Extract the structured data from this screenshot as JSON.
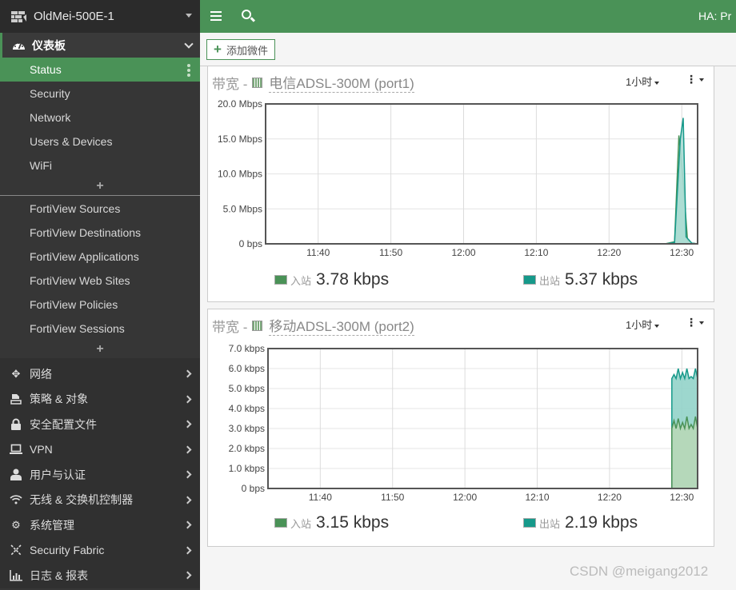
{
  "sidebar": {
    "device_name": "OldMei-500E-1",
    "dashboard_label": "仪表板",
    "dashboard_items": [
      {
        "label": "Status",
        "active": true
      },
      {
        "label": "Security"
      },
      {
        "label": "Network"
      },
      {
        "label": "Users & Devices"
      },
      {
        "label": "WiFi"
      }
    ],
    "add_label": "+",
    "fortiview_items": [
      {
        "label": "FortiView Sources"
      },
      {
        "label": "FortiView Destinations"
      },
      {
        "label": "FortiView Applications"
      },
      {
        "label": "FortiView Web Sites"
      },
      {
        "label": "FortiView Policies"
      },
      {
        "label": "FortiView Sessions"
      }
    ],
    "nav_items": [
      {
        "label": "网络",
        "icon": "move-arrows-icon"
      },
      {
        "label": "策略 & 对象",
        "icon": "policy-icon"
      },
      {
        "label": "安全配置文件",
        "icon": "lock-icon"
      },
      {
        "label": "VPN",
        "icon": "laptop-icon"
      },
      {
        "label": "用户与认证",
        "icon": "user-icon"
      },
      {
        "label": "无线 & 交换机控制器",
        "icon": "wifi-icon"
      },
      {
        "label": "系统管理",
        "icon": "gear-icon"
      },
      {
        "label": "Security Fabric",
        "icon": "fabric-icon"
      },
      {
        "label": "日志 & 报表",
        "icon": "bar-chart-icon"
      }
    ]
  },
  "topbar": {
    "ha_label": "HA: Pr"
  },
  "toolbar": {
    "add_widget_label": "添加微件"
  },
  "colors": {
    "accent": "#4a9257",
    "inbound": "#4a9257",
    "outbound": "#16998a"
  },
  "chart_data": [
    {
      "type": "area",
      "title": "带宽 -",
      "interface": "电信ADSL-300M (port1)",
      "time_range": "1小时",
      "xlabel": "",
      "ylabel": "",
      "x_ticks": [
        "11:40",
        "11:50",
        "12:00",
        "12:10",
        "12:20",
        "12:30"
      ],
      "y_ticks": [
        "0 bps",
        "5.0 Mbps",
        "10.0 Mbps",
        "15.0 Mbps",
        "20.0 Mbps"
      ],
      "ylim": [
        0,
        20
      ],
      "y_unit": "Mbps",
      "x_range_minutes": [
        0,
        60
      ],
      "grid": true,
      "series": [
        {
          "name": "入站",
          "color": "#4a9257",
          "fill": "#c8e2c8",
          "x": [
            0,
            55.5,
            56.8,
            57.4,
            58.0,
            58.6,
            59.2,
            60
          ],
          "values": [
            0,
            0,
            0.3,
            15.5,
            9.0,
            0.5,
            0.1,
            0
          ]
        },
        {
          "name": "出站",
          "color": "#16998a",
          "fill": "#a8dcd4",
          "x": [
            0,
            55.5,
            56.8,
            57.6,
            58.0,
            58.4,
            59.2,
            60
          ],
          "values": [
            0,
            0,
            0.2,
            15.0,
            18.0,
            1.0,
            0.1,
            0
          ]
        }
      ],
      "legend": [
        {
          "label": "入站",
          "value": "3.78 kbps",
          "color": "#4a9257"
        },
        {
          "label": "出站",
          "value": "5.37 kbps",
          "color": "#16998a"
        }
      ],
      "legend_position": "bottom"
    },
    {
      "type": "area",
      "title": "带宽 -",
      "interface": "移动ADSL-300M (port2)",
      "time_range": "1小时",
      "xlabel": "",
      "ylabel": "",
      "x_ticks": [
        "11:40",
        "11:50",
        "12:00",
        "12:10",
        "12:20",
        "12:30"
      ],
      "y_ticks": [
        "0 bps",
        "1.0 kbps",
        "2.0 kbps",
        "3.0 kbps",
        "4.0 kbps",
        "5.0 kbps",
        "6.0 kbps",
        "7.0 kbps"
      ],
      "ylim": [
        0,
        7
      ],
      "y_unit": "kbps",
      "x_range_minutes": [
        0,
        60
      ],
      "grid": true,
      "series": [
        {
          "name": "出站",
          "color": "#16998a",
          "fill": "#92d3c9",
          "x": [
            56.4,
            56.4,
            56.7,
            57.0,
            57.3,
            57.6,
            57.9,
            58.2,
            58.5,
            58.8,
            59.1,
            59.4,
            59.7,
            60,
            60
          ],
          "values": [
            0,
            5.5,
            5.7,
            5.5,
            6.0,
            5.5,
            5.8,
            5.5,
            6.0,
            5.5,
            5.6,
            5.5,
            6.0,
            5.5,
            0
          ]
        },
        {
          "name": "入站",
          "color": "#4a9257",
          "fill": "#b8d8b8",
          "x": [
            56.4,
            56.4,
            56.7,
            57.0,
            57.3,
            57.6,
            57.9,
            58.2,
            58.5,
            58.8,
            59.1,
            59.4,
            59.7,
            60,
            60
          ],
          "values": [
            0,
            3.0,
            3.4,
            3.0,
            3.5,
            3.0,
            3.3,
            3.0,
            3.6,
            3.0,
            3.2,
            3.0,
            3.6,
            3.0,
            0
          ]
        }
      ],
      "legend": [
        {
          "label": "入站",
          "value": "3.15 kbps",
          "color": "#4a9257"
        },
        {
          "label": "出站",
          "value": "2.19 kbps",
          "color": "#16998a"
        }
      ],
      "legend_position": "bottom"
    }
  ],
  "watermark": "CSDN @meigang2012"
}
